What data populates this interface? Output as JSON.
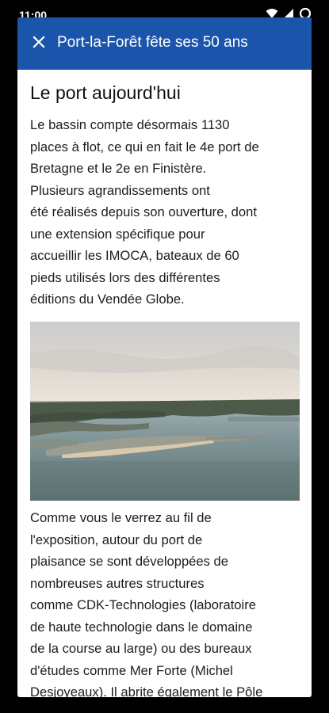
{
  "status_bar": {
    "time": "11:00",
    "icons": [
      "wifi-icon",
      "signal-icon",
      "battery-icon"
    ]
  },
  "app_bar": {
    "title": "Port-la-Forêt fête ses 50 ans",
    "close_icon": "close-icon",
    "color": "#1b55ab"
  },
  "article": {
    "heading": "Le port aujourd'hui",
    "paragraph_1": [
      "Le bassin compte désormais 1130",
      "places à flot, ce qui en fait le 4e port de",
      "Bretagne et le 2e en Finistère.",
      "Plusieurs agrandissements ont",
      "été réalisés depuis son ouverture, dont",
      "une extension spécifique pour",
      "accueillir les IMOCA, bateaux de 60",
      "pieds utilisés lors des différentes",
      "éditions du Vendée Globe."
    ],
    "paragraph_2": [
      "Comme vous le verrez au fil de",
      "l'exposition, autour du port de",
      "plaisance se sont développées de",
      "nombreuses autres structures",
      "comme CDK-Technologies (laboratoire",
      "de haute technologie dans le domaine",
      "de la course au large) ou des bureaux",
      "d'études comme Mer Forte (Michel",
      "Desjoyeaux). Il abrite également le Pôle"
    ]
  }
}
